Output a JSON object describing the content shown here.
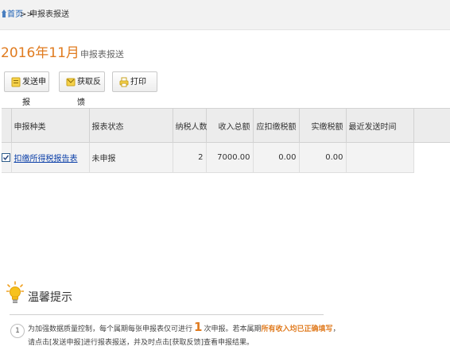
{
  "breadcrumb": {
    "home": "首页",
    "separator": ">>",
    "current": "申报表报送"
  },
  "heading": {
    "period": "2016年11月",
    "subtitle": "申报表报送"
  },
  "toolbar": {
    "send_label": "发送申报",
    "feedback_label": "获取反馈",
    "print_label": "打印"
  },
  "table": {
    "headers": {
      "report_type": "申报种类",
      "status": "报表状态",
      "taxpayers": "纳税人数",
      "total_income": "收入总额",
      "tax_withheld": "应扣缴税额",
      "tax_paid": "实缴税额",
      "last_sent": "最近发送时间"
    },
    "rows": [
      {
        "checked": true,
        "report_type": "扣缴所得税报告表",
        "status": "未申报",
        "taxpayers": "2",
        "total_income": "7000.00",
        "tax_withheld": "0.00",
        "tax_paid": "0.00",
        "last_sent": ""
      }
    ]
  },
  "tips": {
    "title": "温馨提示",
    "items": [
      {
        "number": "1",
        "text_before": "为加强数据质量控制，每个属期每张申报表仅可进行",
        "count": "1",
        "text_middle": "次申报。若本属期",
        "highlight": "所有收入均已正确填写",
        "text_after": "，请点击[发送申报]进行报表报送，并及时点击[获取反馈]查看申报结果。"
      }
    ]
  },
  "colors": {
    "accent_orange": "#e07b1f",
    "link_blue": "#0b3fa8",
    "header_gray": "#ececec"
  }
}
